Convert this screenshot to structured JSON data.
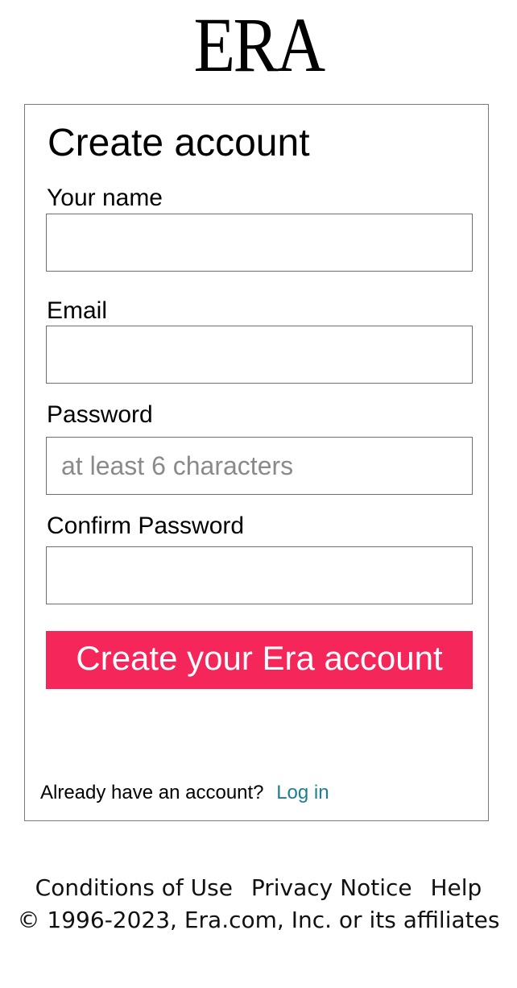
{
  "brand": {
    "logo_text": "ERA"
  },
  "form": {
    "title": "Create account",
    "fields": [
      {
        "label": "Your name",
        "value": "",
        "placeholder": ""
      },
      {
        "label": "Email",
        "value": "",
        "placeholder": ""
      },
      {
        "label": "Password",
        "value": "",
        "placeholder": "at least 6 characters"
      },
      {
        "label": "Confirm Password",
        "value": "",
        "placeholder": ""
      }
    ],
    "submit_label": "Create your Era account",
    "signin_prompt": "Already have an account?",
    "signin_link": "Log in"
  },
  "footer": {
    "links": [
      "Conditions of Use",
      "Privacy Notice",
      "Help"
    ],
    "copyright": "© 1996-2023, Era.com, Inc. or its affiliates"
  },
  "colors": {
    "accent": "#f4265a",
    "link": "#1a7f92",
    "border": "#6e6e6e"
  }
}
